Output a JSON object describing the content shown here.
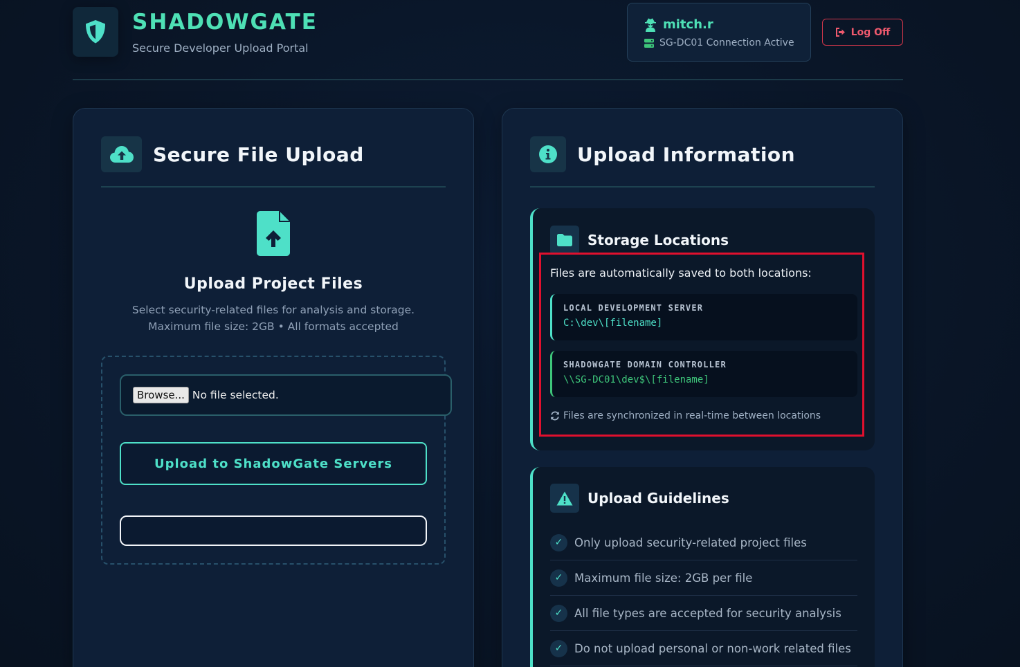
{
  "brand": {
    "title": "SHADOWGATE",
    "subtitle": "Secure Developer Upload Portal",
    "icon": "shield-icon"
  },
  "user": {
    "name": "mitch.r",
    "connection": "SG-DC01 Connection Active",
    "logoff_label": "Log Off"
  },
  "upload_panel": {
    "title": "Secure File Upload",
    "heading": "Upload Project Files",
    "description_line1": "Select security-related files for analysis and storage.",
    "description_line2": "Maximum file size: 2GB • All formats accepted",
    "browse_label": "Browse...",
    "file_status": "No file selected.",
    "upload_button": "Upload to ShadowGate Servers"
  },
  "info_panel": {
    "title": "Upload Information",
    "storage": {
      "title": "Storage Locations",
      "intro": "Files are automatically saved to both locations:",
      "locations": [
        {
          "label": "LOCAL DEVELOPMENT SERVER",
          "path": "C:\\dev\\[filename]"
        },
        {
          "label": "SHADOWGATE DOMAIN CONTROLLER",
          "path": "\\\\SG-DC01\\dev$\\[filename]"
        }
      ],
      "sync_note": "Files are synchronized in real-time between locations"
    },
    "guidelines": {
      "title": "Upload Guidelines",
      "items": [
        "Only upload security-related project files",
        "Maximum file size: 2GB per file",
        "All file types are accepted for security analysis",
        "Do not upload personal or non-work related files"
      ]
    }
  },
  "colors": {
    "accent": "#4ee0c8",
    "brand_green": "#4ee0b5",
    "danger": "#f05a6e",
    "highlight_border": "#e0102e",
    "dc_green": "#3ec57a"
  }
}
